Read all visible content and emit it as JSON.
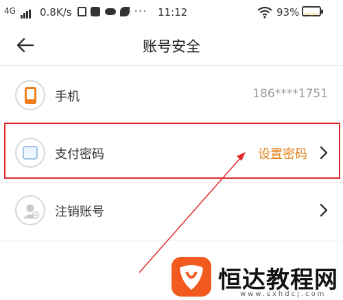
{
  "status_bar": {
    "network": "4G",
    "speed": "0.8K/s",
    "icons": [
      "sim-card-icon",
      "message-icon",
      "cloud-icon",
      "fan-icon",
      "more-icon"
    ],
    "more_glyph": "···",
    "time": "11:12",
    "battery_percent": "93%",
    "battery_level": 0.93
  },
  "nav": {
    "title": "账号安全"
  },
  "rows": [
    {
      "label": "手机",
      "value": "186****1751",
      "icon": "phone-icon",
      "color": "#f07f1a"
    },
    {
      "label": "支付密码",
      "action": "设置密码",
      "icon": "card-icon",
      "action_color": "#e0821e",
      "highlighted": true
    },
    {
      "label": "注销账号",
      "icon": "user-remove-icon"
    }
  ],
  "annotation": {
    "color": "#e1282c"
  },
  "watermark": {
    "text": "恒达教程网",
    "url": "www.sxhdcj.com",
    "logo_color": "#f25a1f"
  }
}
